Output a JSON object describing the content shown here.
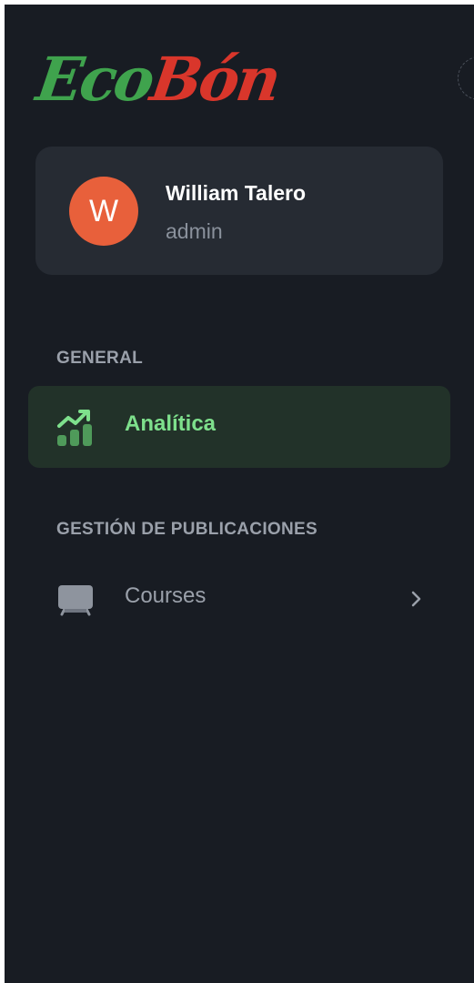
{
  "brand": {
    "part1": "Eco",
    "part2": "Bón",
    "color1": "#3fa34d",
    "color2": "#d9362b"
  },
  "user": {
    "initial": "W",
    "name": "William Talero",
    "role": "admin",
    "avatar_color": "#e8603b"
  },
  "sections": {
    "general": {
      "title": "GENERAL",
      "items": [
        {
          "label": "Analítica",
          "icon": "analytics-chart-icon",
          "active": true
        }
      ]
    },
    "publications": {
      "title": "GESTIÓN DE PUBLICACIONES",
      "items": [
        {
          "label": "Courses",
          "icon": "screen-board-icon",
          "active": false,
          "expandable": true
        }
      ]
    }
  },
  "colors": {
    "active_bg": "#223229",
    "active_text": "#7ee08c",
    "panel_bg": "#181c23"
  }
}
